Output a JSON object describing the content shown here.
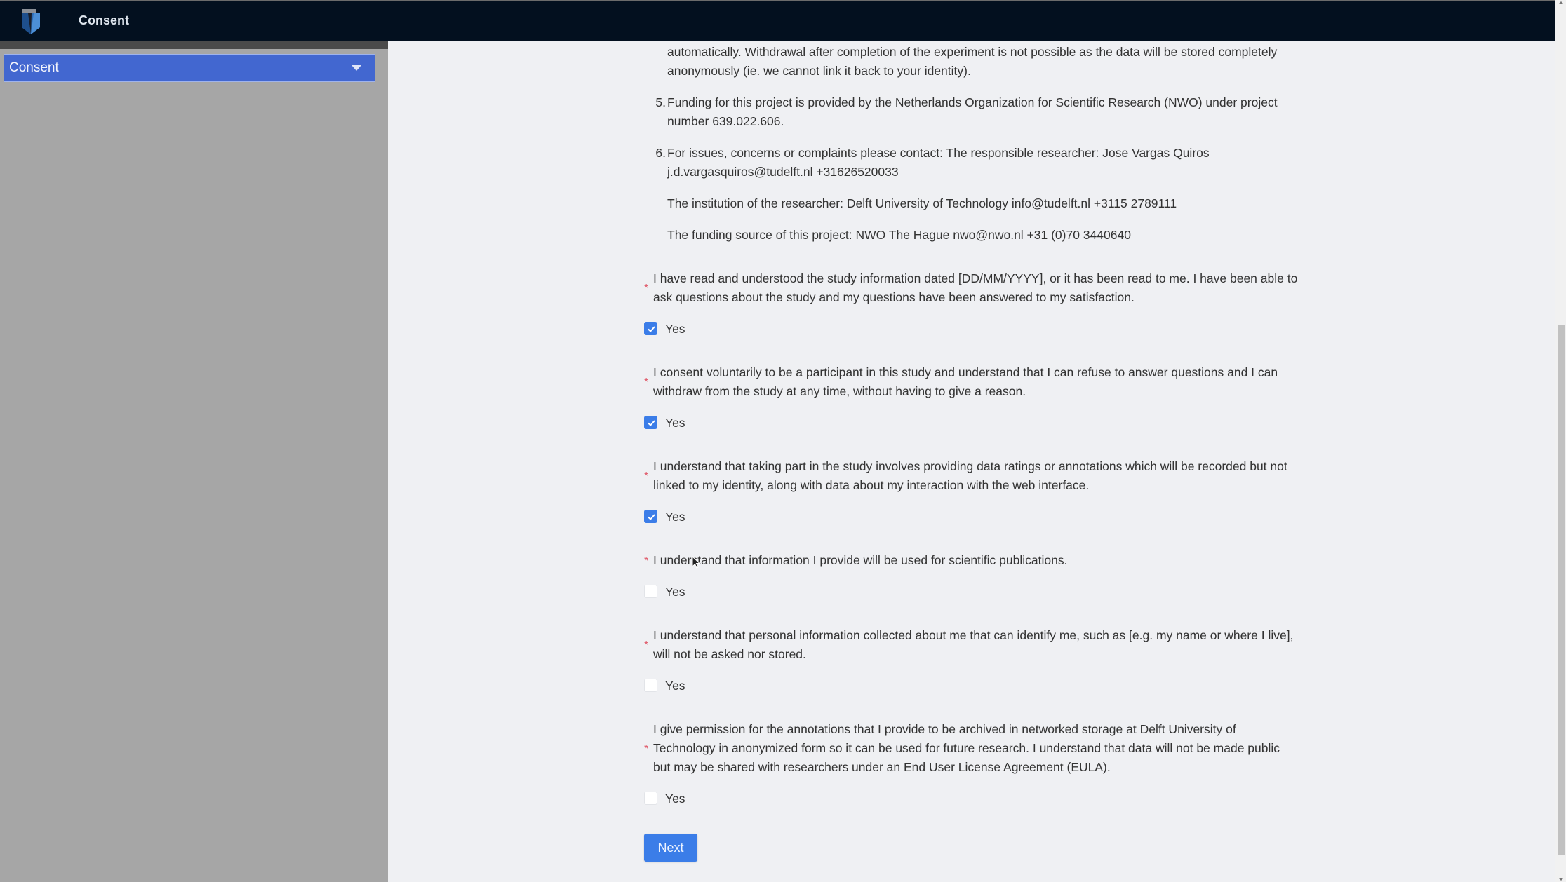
{
  "header": {
    "logo_icon": "shield-logo-icon",
    "title": "Consent"
  },
  "sidebar": {
    "nav_select": {
      "selected": "Consent",
      "icon": "caret-down-icon"
    }
  },
  "info_list": {
    "item4_continuation": "automatically. Withdrawal after completion of the experiment is not possible as the data will be stored completely anonymously (ie. we cannot link it back to your identity).",
    "items": [
      {
        "number": "5.",
        "text": "Funding for this project is provided by the Netherlands Organization for Scientific Research (NWO) under project number 639.022.606."
      },
      {
        "number": "6.",
        "text": "For issues, concerns or complaints please contact: The responsible researcher: Jose Vargas Quiros j.d.vargasquiros@tudelft.nl +31626520033",
        "extra": [
          "The institution of the researcher: Delft University of Technology info@tudelft.nl +3115 2789111",
          "The funding source of this project: NWO The Hague nwo@nwo.nl +31 (0)70 3440640"
        ]
      }
    ]
  },
  "questions": [
    {
      "required_mark": "*",
      "text": "I have read and understood the study information dated [DD/MM/YYYY], or it has been read to me. I have been able to ask questions about the study and my questions have been answered to my satisfaction.",
      "option_label": "Yes",
      "checked": true
    },
    {
      "required_mark": "*",
      "text": "I consent voluntarily to be a participant in this study and understand that I can refuse to answer questions and I can withdraw from the study at any time, without having to give a reason.",
      "option_label": "Yes",
      "checked": true
    },
    {
      "required_mark": "*",
      "text": "I understand that taking part in the study involves providing data ratings or annotations which will be recorded but not linked to my identity, along with data about my interaction with the web interface.",
      "option_label": "Yes",
      "checked": true
    },
    {
      "required_mark": "*",
      "text": "I understand that information I provide will be used for scientific publications.",
      "option_label": "Yes",
      "checked": false
    },
    {
      "required_mark": "*",
      "text": "I understand that personal information collected about me that can identify me, such as [e.g. my name or where I live], will not be asked nor stored.",
      "option_label": "Yes",
      "checked": false
    },
    {
      "required_mark": "*",
      "text": "I give permission for the annotations that I provide to be archived in networked storage at Delft University of Technology in anonymized form so it can be used for future research. I understand that data will not be made public but may be shared with researchers under an End User License Agreement (EULA).",
      "option_label": "Yes",
      "checked": false
    }
  ],
  "actions": {
    "next_label": "Next"
  },
  "colors": {
    "header_bg": "#03101f",
    "sidebar_bg": "#a6a6a6",
    "nav_select_bg": "#4267d0",
    "accent": "#3b7de8",
    "required": "#e05a6a",
    "page_bg": "#eff0f3"
  }
}
